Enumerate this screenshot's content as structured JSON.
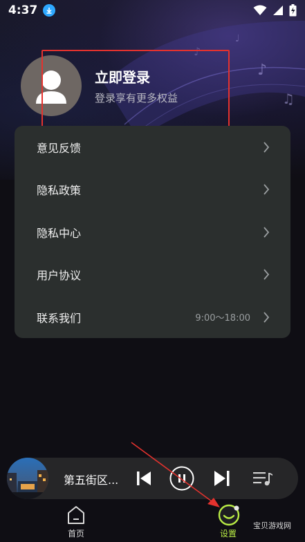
{
  "status_bar": {
    "time": "4:37",
    "icons": [
      "download-icon",
      "wifi-icon",
      "signal-icon",
      "battery-icon"
    ]
  },
  "profile": {
    "title": "立即登录",
    "subtitle": "登录享有更多权益"
  },
  "menu": {
    "items": [
      {
        "label": "意见反馈",
        "extra": ""
      },
      {
        "label": "隐私政策",
        "extra": ""
      },
      {
        "label": "隐私中心",
        "extra": ""
      },
      {
        "label": "用户协议",
        "extra": ""
      },
      {
        "label": "联系我们",
        "extra": "9:00～18:00"
      }
    ]
  },
  "player": {
    "song_title": "第五街区...",
    "controls": [
      "previous-icon",
      "pause-icon",
      "next-icon",
      "playlist-icon"
    ]
  },
  "tabbar": {
    "tabs": [
      {
        "label": "首页",
        "active": false,
        "color": "#dcdcdc"
      },
      {
        "label": "设置",
        "active": true,
        "color": "#b9ec45"
      }
    ]
  },
  "watermark": "宝贝游戏网",
  "colors": {
    "accent": "#b9ec45",
    "highlight_box": "#e5322e",
    "annotation_arrow": "#e5322e",
    "card_bg": "#2b2f2e",
    "download_badge": "#2ea8ff"
  }
}
